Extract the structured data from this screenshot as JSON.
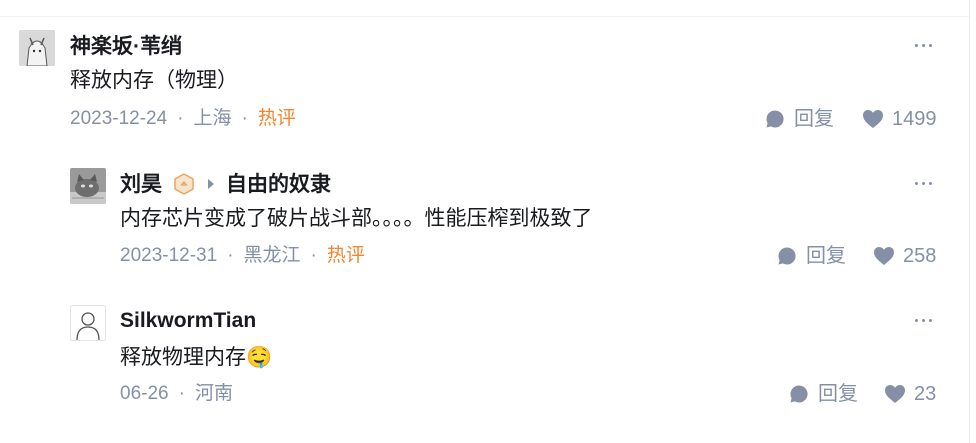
{
  "comments": [
    {
      "author": "神楽坂·苇绡",
      "content": "释放内存（物理）",
      "date": "2023-12-24",
      "location": "上海",
      "hot_tag": "热评",
      "reply_label": "回复",
      "likes": "1499"
    },
    {
      "author": "刘昊",
      "reply_to": "自由的奴隶",
      "content": "内存芯片变成了破片战斗部。。。。性能压榨到极致了",
      "date": "2023-12-31",
      "location": "黑龙江",
      "hot_tag": "热评",
      "reply_label": "回复",
      "likes": "258"
    },
    {
      "author": "SilkwormTian",
      "content": "释放物理内存",
      "emoji": "🤤",
      "date": "06-26",
      "location": "河南",
      "reply_label": "回复",
      "likes": "23"
    }
  ],
  "separator": "·",
  "colors": {
    "text": "#191b1f",
    "meta": "#8590a6",
    "hot": "#f1862f",
    "badge": "#e8a862"
  },
  "icons": [
    "more-icon",
    "comment-bubble-icon",
    "heart-icon",
    "creator-badge-icon",
    "reply-arrow-icon"
  ]
}
